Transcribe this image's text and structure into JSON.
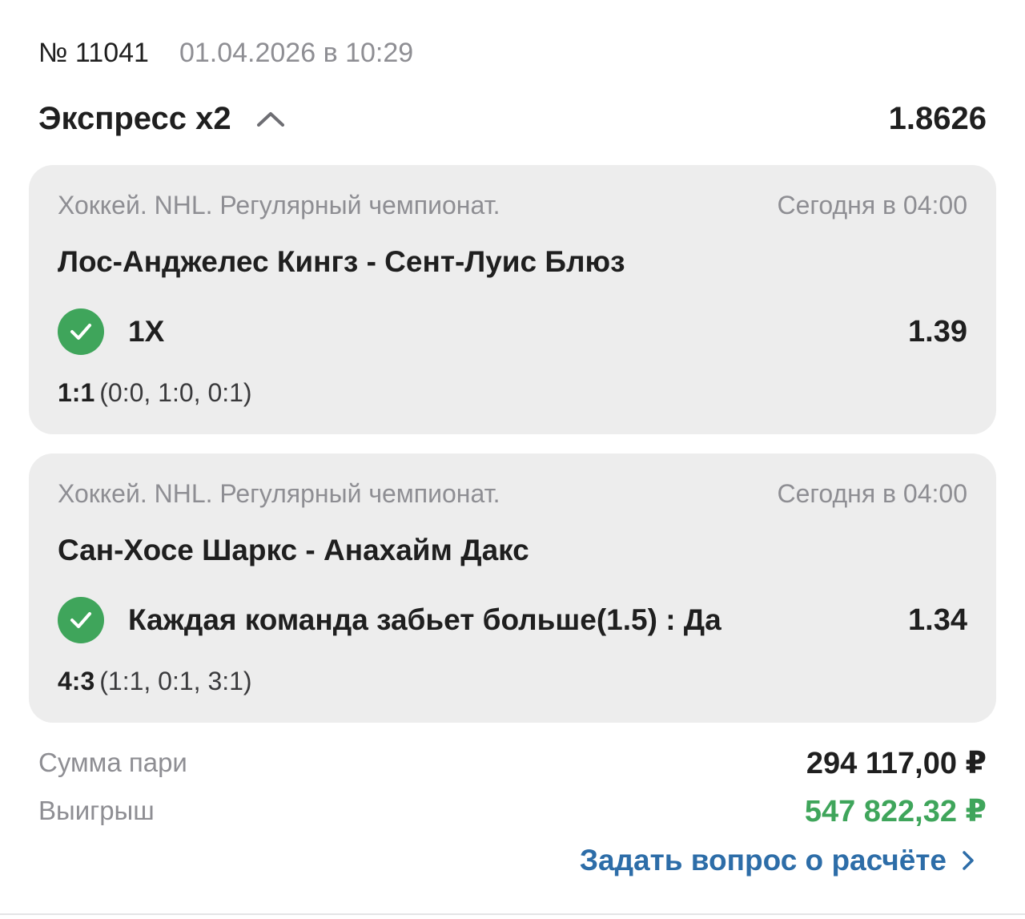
{
  "header": {
    "bet_number": "№ 11041",
    "datetime": "01.04.2026 в 10:29"
  },
  "express": {
    "title": "Экспресс x2",
    "total_odds": "1.8626",
    "toggle_icon": "chevron-up-icon"
  },
  "events": [
    {
      "league": "Хоккей. NHL. Регулярный чемпионат.",
      "time": "Сегодня в 04:00",
      "teams": "Лос-Анджелес Кингз - Сент-Луис Блюз",
      "outcome": "1X",
      "odds": "1.39",
      "status_icon": "check-circle-icon",
      "score": "1:1",
      "periods": "(0:0, 1:0, 0:1)"
    },
    {
      "league": "Хоккей. NHL. Регулярный чемпионат.",
      "time": "Сегодня в 04:00",
      "teams": "Сан-Хосе Шаркс - Анахайм Дакс",
      "outcome": "Каждая команда забьет больше(1.5) : Да",
      "odds": "1.34",
      "status_icon": "check-circle-icon",
      "score": "4:3",
      "periods": "(1:1, 0:1, 3:1)"
    }
  ],
  "summary": {
    "stake_label": "Сумма пари",
    "stake_value": "294 117,00 ₽",
    "win_label": "Выигрыш",
    "win_value": "547 822,32 ₽"
  },
  "ask_link": {
    "label": "Задать вопрос о расчёте"
  },
  "colors": {
    "accent_green": "#3fa55b",
    "link_blue": "#2d6da8",
    "muted_text": "#8e8e93",
    "card_bg": "#ededed"
  }
}
